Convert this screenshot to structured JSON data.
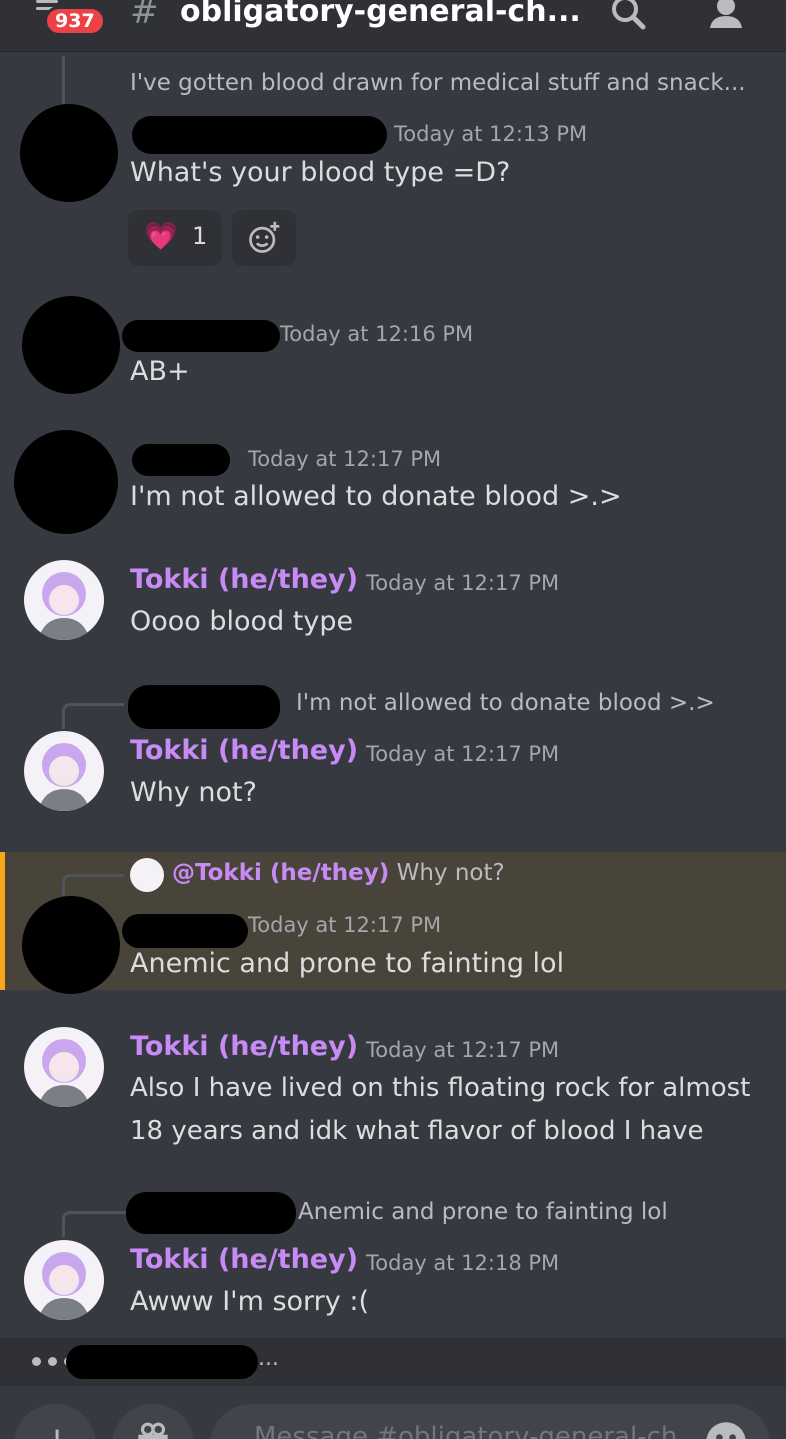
{
  "header": {
    "unread_badge": "937",
    "hash": "#",
    "channel_name": "obligatory-general-ch..."
  },
  "messages": [
    {
      "reply_preview": "I've gotten blood drawn for medical stuff and snack...",
      "time": "Today at 12:13 PM",
      "text": "What's your blood type =D?",
      "reaction": {
        "emoji": "💗",
        "count": "1"
      }
    },
    {
      "time": "Today at 12:16 PM",
      "text": "AB+"
    },
    {
      "time": "Today at 12:17 PM",
      "text": "I'm not allowed to donate blood >.>"
    },
    {
      "author": "Tokki (he/they)",
      "time": "Today at 12:17 PM",
      "text": "Oooo blood type"
    },
    {
      "reply_text": "I'm not allowed to donate blood >.>",
      "author": "Tokki (he/they)",
      "time": "Today at 12:17 PM",
      "text": "Why not?"
    },
    {
      "reply_author": "@Tokki (he/they)",
      "reply_text": "Why not?",
      "time": "Today at 12:17 PM",
      "text": "Anemic and prone to fainting lol"
    },
    {
      "author": "Tokki (he/they)",
      "time": "Today at 12:17 PM",
      "text_line1": "Also I have lived on this floating rock for almost",
      "text_line2": "18 years and idk what flavor of blood I have"
    },
    {
      "reply_text": "Anemic and prone to fainting lol",
      "author": "Tokki (he/they)",
      "time": "Today at 12:18 PM",
      "text": "Awww I'm sorry :("
    }
  ],
  "typing": {
    "suffix": "..."
  },
  "composer": {
    "plus": "+",
    "placeholder": "Message #obligatory-general-ch"
  },
  "colors": {
    "background": "#36393f",
    "header": "#2f3136",
    "author_tokki": "#c88af5",
    "mention_highlight": "#49443a",
    "mention_bar": "#faa61a",
    "badge": "#ed4245"
  },
  "icons": [
    "hamburger-icon",
    "search-icon",
    "members-icon",
    "add-reaction-icon",
    "gift-icon",
    "emoji-icon"
  ]
}
